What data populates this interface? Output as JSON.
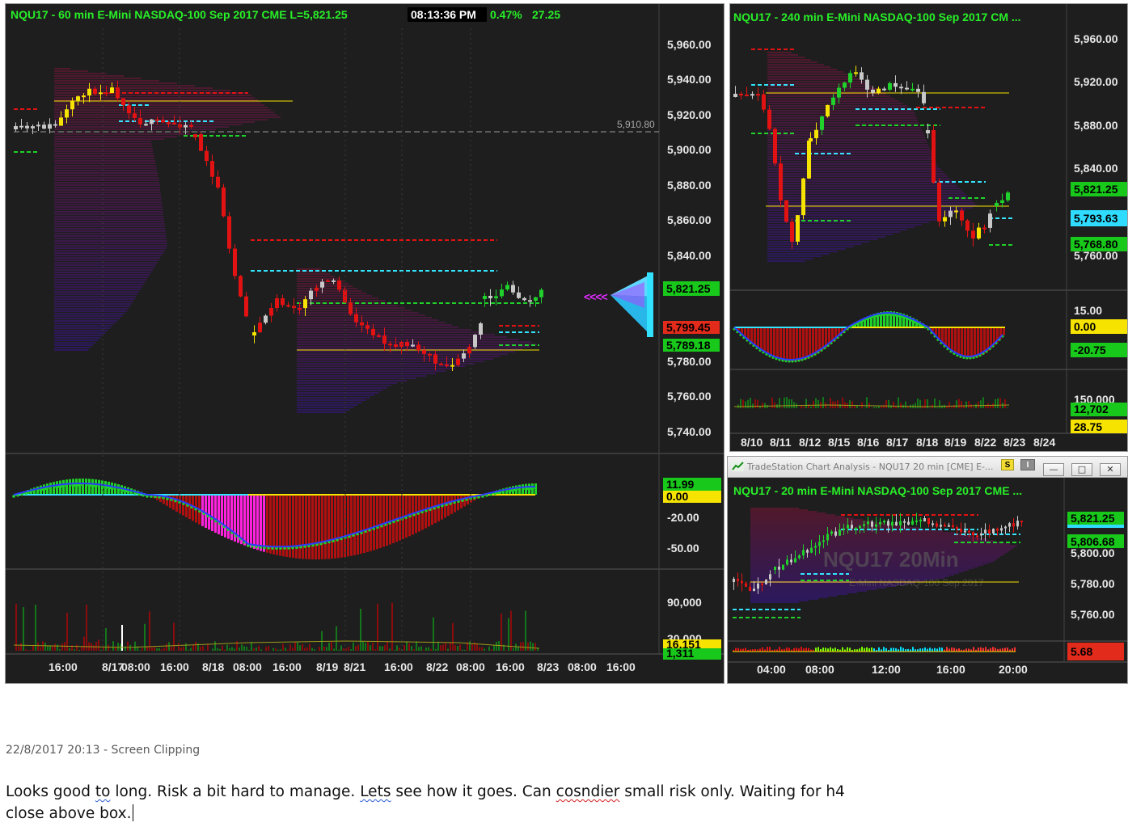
{
  "colors": {
    "up": "#1fd12a",
    "down": "#e31212",
    "yellow": "#f6e400",
    "cyan": "#33e5ff",
    "magenta": "#ff22dd",
    "grey": "#c8c8c8"
  },
  "chart60": {
    "title": "NQU17 - 60 min  E-Mini NASDAQ-100 Sep 2017  CME  L=5,821.25",
    "time": "08:13:36 PM",
    "pct": "0.47%",
    "chg": "27.25",
    "ref_line_label": "5,910.80",
    "price_axis": [
      "5,960.00",
      "5,940.00",
      "5,920.00",
      "5,900.00",
      "5,880.00",
      "5,860.00",
      "5,840.00",
      "5,780.00",
      "5,760.00",
      "5,740.00"
    ],
    "price_tags": {
      "last": "5,821.25",
      "a": "5,799.45",
      "b": "5,789.18"
    },
    "osc_axis": [
      "-20.00",
      "-50.00"
    ],
    "osc_tags": {
      "a": "11.99",
      "b": "0.00"
    },
    "vol_axis": [
      "90,000",
      "30,000"
    ],
    "vol_tags": {
      "a": "16,151",
      "b": "1,311"
    },
    "time_axis": [
      "16:00",
      "8/17",
      "08:00",
      "16:00",
      "8/18",
      "08:00",
      "16:00",
      "8/19",
      "8/21",
      "16:00",
      "8/22",
      "08:00",
      "16:00",
      "8/23",
      "08:00",
      "16:00"
    ],
    "pointer_glyphs": "<<<<"
  },
  "chart240": {
    "title": "NQU17 - 240 min  E-Mini NASDAQ-100 Sep 2017  CM ...",
    "price_axis": [
      "5,960.00",
      "5,920.00",
      "5,880.00",
      "5,840.00",
      "5,760.00"
    ],
    "price_tags": {
      "a": "5,821.25",
      "b": "5,793.63",
      "c": "5,768.80"
    },
    "osc_axis": [
      "15.00"
    ],
    "osc_tags": {
      "a": "0.00",
      "b": "-20.75"
    },
    "vol_axis": [
      "150,000"
    ],
    "vol_tags": {
      "a": "12,702",
      "b": "28.75"
    },
    "time_axis": [
      "8/10",
      "8/11",
      "8/12",
      "8/15",
      "8/16",
      "8/17",
      "8/18",
      "8/19",
      "8/22",
      "8/23",
      "8/24"
    ]
  },
  "chart20": {
    "window_title": "TradeStation Chart Analysis - NQU17 20 min [CME] E-...",
    "badge_s": "S",
    "badge_i": "I",
    "btn_min": "—",
    "btn_max": "□",
    "btn_close": "✕",
    "title": "NQU17 - 20 min  E-Mini NASDAQ-100 Sep 2017  CME ...",
    "watermark": "NQU17 20Min",
    "watermark_sub": "E-Mini NASDAQ-100 Sep 2017",
    "price_axis": [
      "5,800.00",
      "5,780.00",
      "5,760.00"
    ],
    "price_tags": {
      "a": "5,821.25",
      "b": "5,806.68"
    },
    "osc_tag": "5.68",
    "time_axis": [
      "04:00",
      "08:00",
      "12:00",
      "16:00",
      "20:00"
    ]
  },
  "note": {
    "meta": "22/8/2017 20:13 - Screen Clipping",
    "text_parts": [
      "Looks good ",
      "to",
      " long. Risk a bit hard to manage. ",
      "Lets",
      " see how it goes. Can ",
      "cosndier",
      " small risk only. Waiting for h4 close above box."
    ]
  }
}
